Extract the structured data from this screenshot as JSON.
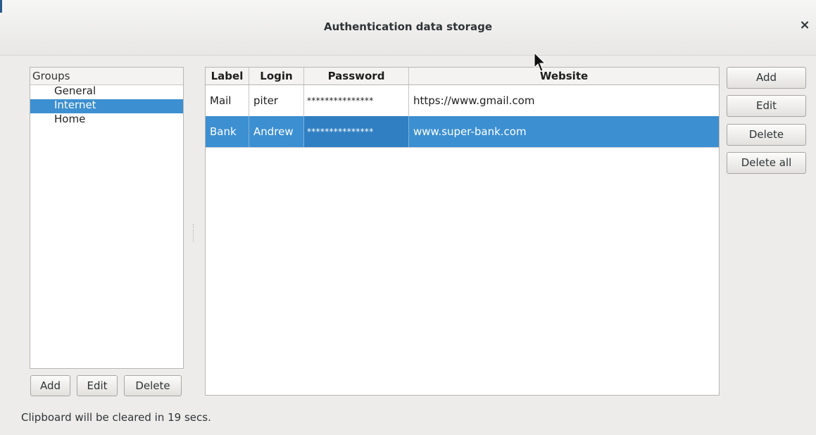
{
  "window": {
    "title": "Authentication data storage",
    "close_glyph": "×"
  },
  "groups": {
    "header": "Groups",
    "items": [
      "General",
      "Internet",
      "Home"
    ],
    "selected": "Internet",
    "buttons": {
      "add": "Add",
      "edit": "Edit",
      "delete": "Delete"
    }
  },
  "entries": {
    "columns": [
      "Label",
      "Login",
      "Password",
      "Website"
    ],
    "rows": [
      {
        "label": "Mail",
        "login": "piter",
        "password": "***************",
        "website": "https://www.gmail.com"
      },
      {
        "label": "Bank",
        "login": "Andrew",
        "password": "***************",
        "website": "www.super-bank.com",
        "selected": true
      }
    ]
  },
  "actions": {
    "add": "Add",
    "edit": "Edit",
    "delete": "Delete",
    "delete_all": "Delete all"
  },
  "status": "Clipboard will be cleared in 19 secs.",
  "colors": {
    "selection": "#3c8fd1",
    "background": "#edeceb"
  }
}
